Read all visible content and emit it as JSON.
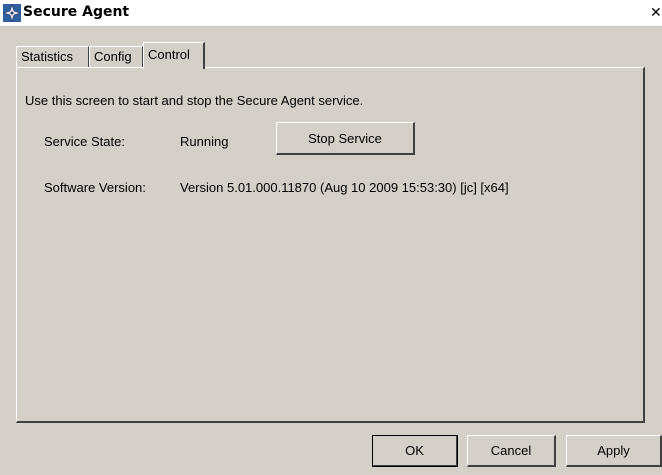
{
  "window": {
    "title": "Secure Agent",
    "close_label": "✕"
  },
  "tabs": [
    {
      "label": "Statistics"
    },
    {
      "label": "Config"
    },
    {
      "label": "Control",
      "active": true
    }
  ],
  "control": {
    "intro": "Use this screen to start and stop the Secure Agent service.",
    "service_state_label": "Service State:",
    "service_state_value": "Running",
    "stop_service_label": "Stop Service",
    "software_version_label": "Software Version:",
    "software_version_value": "Version 5.01.000.11870 (Aug 10 2009 15:53:30) [jc] [x64]"
  },
  "footer": {
    "ok_label": "OK",
    "cancel_label": "Cancel",
    "apply_label": "Apply"
  },
  "icons": {
    "app": "compass-star-icon",
    "close": "close-icon"
  },
  "colors": {
    "face": "#d4d0c8",
    "shadow": "#404040",
    "highlight": "#ffffff"
  }
}
